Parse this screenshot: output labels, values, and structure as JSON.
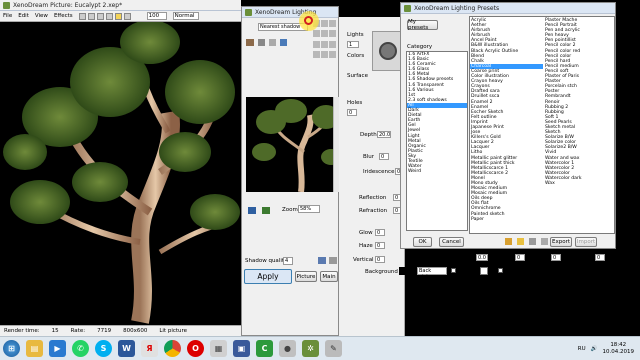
{
  "picture_window": {
    "title": "XenoDream Picture: Eucalypt 2.xep*",
    "menu": [
      "File",
      "Edit",
      "View",
      "Effects"
    ],
    "zoom_value": "100",
    "blend_mode": "Normal"
  },
  "lighting_window": {
    "title": "XenoDream Lighting",
    "preset_value": "Nearest shadow",
    "labels": {
      "lights": "Lights",
      "colors": "Colors",
      "surface": "Surface",
      "holes": "Holes",
      "depth": "Depth",
      "blur": "Blur",
      "iridescence": "Iridescence",
      "reflection": "Reflection",
      "refraction": "Refraction",
      "glow": "Glow",
      "haze": "Haze",
      "vertical": "Vertical",
      "background": "Background",
      "zoom": "Zoom",
      "shadow_quality": "Shadow quality"
    },
    "values": {
      "lights": "1",
      "holes": "0",
      "depth": "20.0",
      "blur": "0",
      "iridescence": "0",
      "reflection": "0",
      "refraction": "0",
      "glow": "0",
      "haze": "0",
      "vertical": "0",
      "zoom": "58%",
      "shadow_quality": "4"
    },
    "bottom_controls": {
      "frequency": "Frequency",
      "frequency_value": "0.0",
      "radius": "Radius",
      "radius_value": "0",
      "swirl": "Swirl",
      "swirl_value": "0",
      "rotation": "Rotation",
      "rotation_value": "0",
      "back_picture": "Back picture",
      "back_haze": "Back Haze",
      "haze_pre_glow": "Haze Pre Glow"
    },
    "buttons": {
      "apply": "Apply",
      "picture": "Picture",
      "main": "Main"
    }
  },
  "presets_window": {
    "title": "XenoDream Lighting Presets",
    "my_presets": "My presets",
    "category_label": "Category",
    "categories": [
      "1.6 ArtFX",
      "1.6 Basic",
      "1.6 Ceramic",
      "1.6 Glass",
      "1.6 Metal",
      "1.6 Shadow presets",
      "1.6 Transparent",
      "1.6 Various",
      "1st",
      "2.3 soft shadows",
      "All",
      "Dark",
      "Dietal",
      "Earth",
      "Gel",
      "Jewel",
      "Light",
      "Metal",
      "Organic",
      "Plastic",
      "Sky",
      "Textile",
      "Water",
      "Weird"
    ],
    "selected_category": "All",
    "col1": [
      "Acrylic",
      "Aether",
      "Airbrush",
      "Airbrush",
      "Ancel Paint",
      "B&W illustration",
      "Black Acrylic Outline",
      "Blend",
      "Chalk",
      "Charcoal",
      "Coarse print",
      "Color illustration",
      "Crayon heavy",
      "Crayons",
      "Drafted sara",
      "Druillet ssca",
      "Enamel 2",
      "Enamel",
      "Escher Sketch",
      "Felt outline",
      "Imprint",
      "Japanese Print",
      "Jose",
      "Killers's Gold",
      "Lacquer 2",
      "Lacquer",
      "Litho",
      "Metallic paint glitter",
      "Metallic paint thick",
      "Metallicscarce 1",
      "Metallicscarce 2",
      "Monel",
      "Mono study",
      "Mosaic medium",
      "Mosaic medium",
      "Oils deep",
      "Oils flat",
      "Omnichrome",
      "Painted sketch",
      "Paper"
    ],
    "col2": [
      "Plaster Mache",
      "Pencil Portrait",
      "Pen and acrylic",
      "Pen heavy",
      "Pen pointillist",
      "Pencil color 2",
      "Pencil color red",
      "Pencil color",
      "Pencil hard",
      "Pencil medium",
      "Pencil soft",
      "Plaster of Paris",
      "Plaster",
      "Porcelain stch",
      "Poster",
      "Rembrandt",
      "Renoir",
      "Rubbing 2",
      "Rubbing",
      "Soft 1",
      "Seed Pearls",
      "Sketch metal",
      "Sketch",
      "Solarize B/W",
      "Solarize color",
      "Solarize2 B/W",
      "Vivid",
      "Water and wax",
      "Watercolor 1",
      "Watercolor 2",
      "Watercolor",
      "Watercolor dark",
      "Wax"
    ],
    "selected_preset": "Charcoal",
    "buttons": {
      "ok": "OK",
      "cancel": "Cancel",
      "export": "Export",
      "import": "Import"
    }
  },
  "status_bar": {
    "render_time": "Render time:",
    "r1": "15",
    "rate": "Rate:",
    "r2": "7719",
    "size": "800x600",
    "status": "Lit picture"
  },
  "taskbar": {
    "time": "18:42",
    "date": "10.04.2019",
    "language": "RU"
  },
  "colors": {
    "selection": "#3399ff",
    "titlebar": "#dbe6f4",
    "apply_bg": "#dbe7f5"
  }
}
